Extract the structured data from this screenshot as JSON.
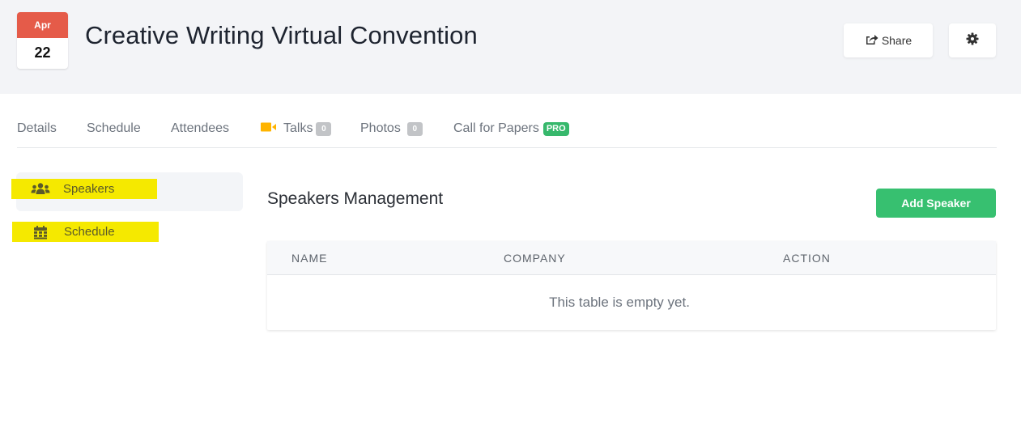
{
  "header": {
    "date": {
      "month": "Apr",
      "day": "22"
    },
    "title": "Creative Writing Virtual Convention",
    "share_label": "Share",
    "settings_icon": "gear-icon"
  },
  "tabs": [
    {
      "label": "Details"
    },
    {
      "label": "Schedule"
    },
    {
      "label": "Attendees"
    },
    {
      "label": "Talks",
      "icon": "video-camera-icon",
      "count": "0"
    },
    {
      "label": "Photos",
      "count": "0"
    },
    {
      "label": "Call for Papers",
      "badge": "PRO"
    }
  ],
  "sidebar": {
    "items": [
      {
        "label": "Speakers",
        "icon": "users-icon",
        "active": true
      },
      {
        "label": "Schedule",
        "icon": "calendar-icon",
        "active": false
      }
    ]
  },
  "main": {
    "title": "Speakers Management",
    "add_button_label": "Add Speaker",
    "table": {
      "columns": [
        "NAME",
        "COMPANY",
        "ACTION"
      ],
      "rows": [],
      "empty_message": "This table is empty yet."
    }
  },
  "colors": {
    "accent_green": "#37c070",
    "date_red": "#e55b49",
    "highlight_yellow": "#f5e900",
    "video_icon_orange": "#ffb400"
  }
}
